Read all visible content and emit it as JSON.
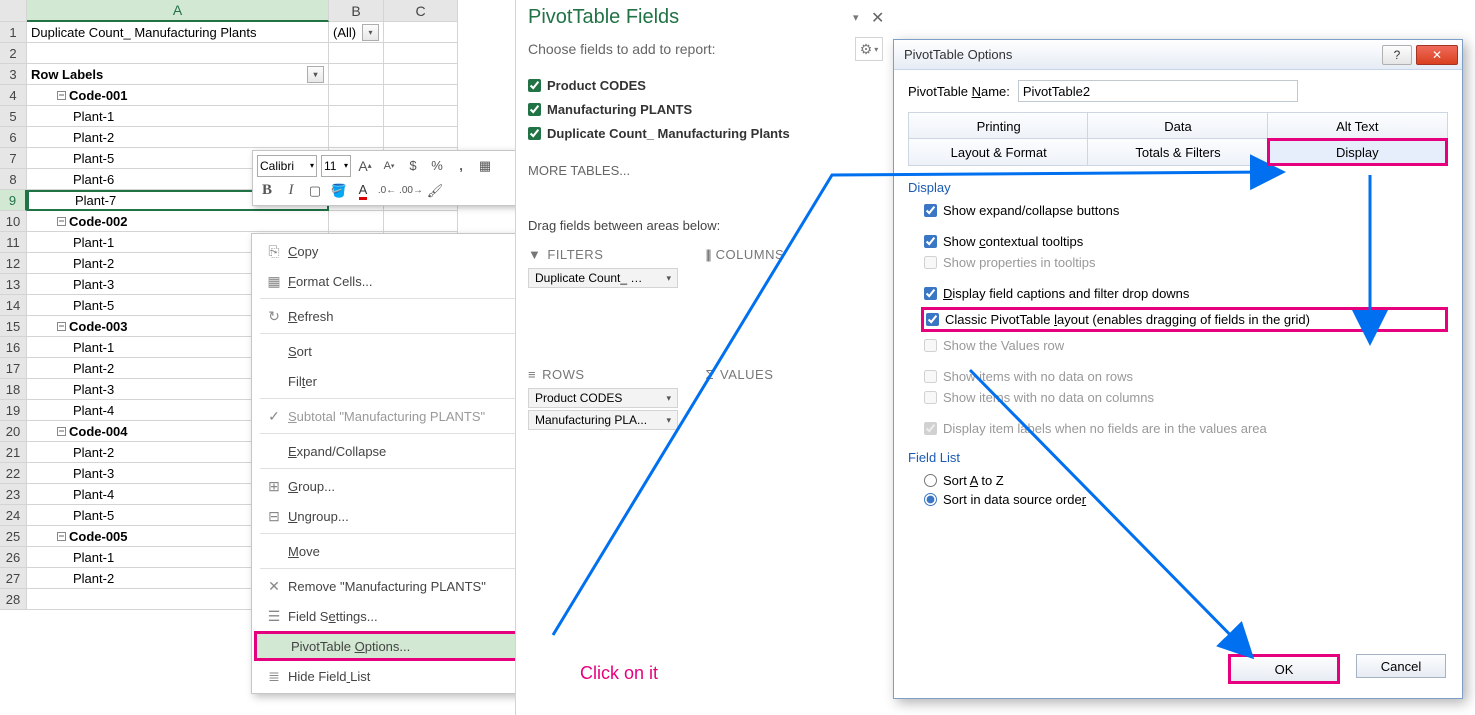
{
  "sheet": {
    "col_labels": [
      "A",
      "B",
      "C"
    ],
    "row_nums": [
      1,
      2,
      3,
      4,
      5,
      6,
      7,
      8,
      9,
      10,
      11,
      12,
      13,
      14,
      15,
      16,
      17,
      18,
      19,
      20,
      21,
      22,
      23,
      24,
      25,
      26,
      27,
      28
    ],
    "rows": [
      {
        "a": "Duplicate Count_ Manufacturing Plants",
        "b": "(All)",
        "dd_b": true
      },
      {
        "a": ""
      },
      {
        "a": "Row Labels",
        "bold": true,
        "dd_a": true
      },
      {
        "a": "Code-001",
        "group": true,
        "bold": true
      },
      {
        "a": "Plant-1",
        "indent": true
      },
      {
        "a": "Plant-2",
        "indent": true
      },
      {
        "a": "Plant-5",
        "indent": true
      },
      {
        "a": "Plant-6",
        "indent": true
      },
      {
        "a": "Plant-7",
        "indent": true,
        "active": true
      },
      {
        "a": "Code-002",
        "group": true,
        "bold": true
      },
      {
        "a": "Plant-1",
        "indent": true
      },
      {
        "a": "Plant-2",
        "indent": true
      },
      {
        "a": "Plant-3",
        "indent": true
      },
      {
        "a": "Plant-5",
        "indent": true
      },
      {
        "a": "Code-003",
        "group": true,
        "bold": true
      },
      {
        "a": "Plant-1",
        "indent": true
      },
      {
        "a": "Plant-2",
        "indent": true
      },
      {
        "a": "Plant-3",
        "indent": true
      },
      {
        "a": "Plant-4",
        "indent": true
      },
      {
        "a": "Code-004",
        "group": true,
        "bold": true
      },
      {
        "a": "Plant-2",
        "indent": true
      },
      {
        "a": "Plant-3",
        "indent": true
      },
      {
        "a": "Plant-4",
        "indent": true
      },
      {
        "a": "Plant-5",
        "indent": true
      },
      {
        "a": "Code-005",
        "group": true,
        "bold": true
      },
      {
        "a": "Plant-1",
        "indent": true
      },
      {
        "a": "Plant-2",
        "indent": true
      },
      {
        "a": ""
      }
    ]
  },
  "minitoolbar": {
    "font": "Calibri",
    "size": "11"
  },
  "ctxmenu": {
    "items": [
      {
        "icon": "copy",
        "label": "Copy",
        "u": 0
      },
      {
        "icon": "cells",
        "label": "Format Cells...",
        "u": 0
      },
      {
        "sep": true
      },
      {
        "icon": "refresh",
        "label": "Refresh",
        "u": 0
      },
      {
        "sep": true
      },
      {
        "label": "Sort",
        "u": 0,
        "sub": true
      },
      {
        "label": "Filter",
        "u": 3,
        "sub": true
      },
      {
        "sep": true
      },
      {
        "icon": "check",
        "label": "Subtotal \"Manufacturing PLANTS\"",
        "u": 0,
        "disabled": true
      },
      {
        "sep": true
      },
      {
        "label": "Expand/Collapse",
        "u": 0,
        "sub": true
      },
      {
        "sep": true
      },
      {
        "icon": "group",
        "label": "Group...",
        "u": 0
      },
      {
        "icon": "ungroup",
        "label": "Ungroup...",
        "u": 0
      },
      {
        "sep": true
      },
      {
        "label": "Move",
        "u": 0,
        "sub": true
      },
      {
        "sep": true
      },
      {
        "icon": "remove",
        "label": "Remove \"Manufacturing PLANTS\"",
        "u": -1
      },
      {
        "icon": "settings",
        "label": "Field Settings...",
        "u": 7
      },
      {
        "label": "PivotTable Options...",
        "u": 11,
        "highlight": true
      },
      {
        "icon": "list",
        "label": "Hide Field List",
        "u": 10
      }
    ]
  },
  "ptfields": {
    "title": "PivotTable Fields",
    "subtitle": "Choose fields to add to report:",
    "fields": [
      {
        "label": "Product CODES",
        "checked": true,
        "bold": true
      },
      {
        "label": "Manufacturing PLANTS",
        "checked": true,
        "bold": true
      },
      {
        "label": "Duplicate Count_ Manufacturing Plants",
        "checked": true,
        "bold": true
      }
    ],
    "more_tables": "MORE TABLES...",
    "areas_msg": "Drag fields between areas below:",
    "filters_hdr": "FILTERS",
    "columns_hdr": "COLUMNS",
    "rows_hdr": "ROWS",
    "values_hdr": "VALUES",
    "filter_items": [
      "Duplicate Count_ …"
    ],
    "row_items": [
      "Product CODES",
      "Manufacturing PLA..."
    ]
  },
  "ptdlg": {
    "title": "PivotTable Options",
    "name_label": "PivotTable Name:",
    "name_value": "PivotTable2",
    "tabs_top": [
      "Printing",
      "Data",
      "Alt Text"
    ],
    "tabs_bot": [
      "Layout & Format",
      "Totals & Filters",
      "Display"
    ],
    "sec_display": "Display",
    "chk_expand": "Show expand/collapse buttons",
    "chk_tooltips": "Show contextual tooltips",
    "chk_props": "Show properties in tooltips",
    "chk_captions": "Display field captions and filter drop downs",
    "chk_classic": "Classic PivotTable layout (enables dragging of fields in the grid)",
    "chk_valuesrow": "Show the Values row",
    "chk_norows": "Show items with no data on rows",
    "chk_nocols": "Show items with no data on columns",
    "chk_itemlabels": "Display item labels when no fields are in the values area",
    "sec_fieldlist": "Field List",
    "radio_az": "Sort A to Z",
    "radio_src": "Sort in data source order",
    "ok": "OK",
    "cancel": "Cancel"
  },
  "annotation": {
    "click_on_it": "Click on it"
  }
}
